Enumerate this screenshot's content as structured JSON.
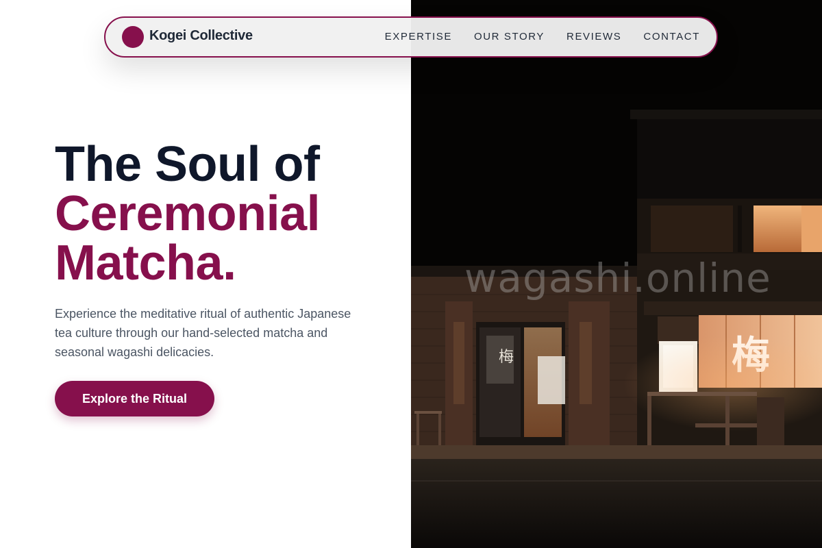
{
  "brand": {
    "name": "Kogei Collective"
  },
  "nav": {
    "links": [
      "EXPERTISE",
      "OUR STORY",
      "REVIEWS",
      "CONTACT"
    ]
  },
  "hero": {
    "headline_line1": "The Soul of",
    "headline_line2": "Ceremonial",
    "headline_line3": "Matcha.",
    "subtext": "Experience the meditative ritual of authentic Japanese tea culture through our hand-selected matcha and seasonal wagashi delicacies.",
    "cta_label": "Explore the Ritual"
  },
  "image": {
    "watermark": "wagashi.online",
    "sign_char": "梅"
  },
  "colors": {
    "accent": "#86104c",
    "headline_dark": "#0f172a",
    "body_text": "#4b5563"
  }
}
